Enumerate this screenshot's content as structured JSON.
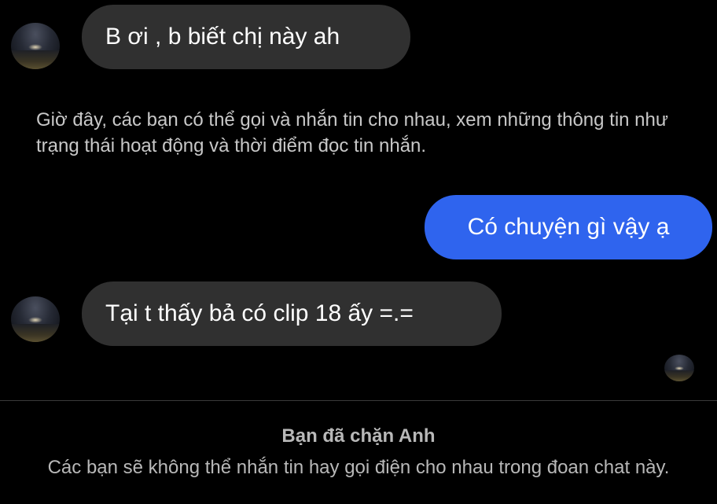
{
  "conversation": {
    "messages": [
      {
        "direction": "incoming",
        "text": "B ơi , b biết chị này ah"
      },
      {
        "direction": "outgoing",
        "text": "Có chuyện gì vậy ạ"
      },
      {
        "direction": "incoming",
        "text": "Tại t thấy bả có clip 18 ấy =.="
      }
    ],
    "system_notice": "Giờ đây, các bạn có thể gọi và nhắn tin cho nhau, xem những thông tin như trạng thái hoạt động và thời điểm đọc tin nhắn."
  },
  "blocked_banner": {
    "title": "Bạn đã chặn Anh",
    "body": "Các bạn sẽ không thể nhắn tin hay gọi điện cho nhau trong đoan chat này."
  },
  "colors": {
    "background": "#000000",
    "incoming_bubble": "#303030",
    "outgoing_bubble": "#2f64ee",
    "muted_text": "#b8b8b8"
  }
}
